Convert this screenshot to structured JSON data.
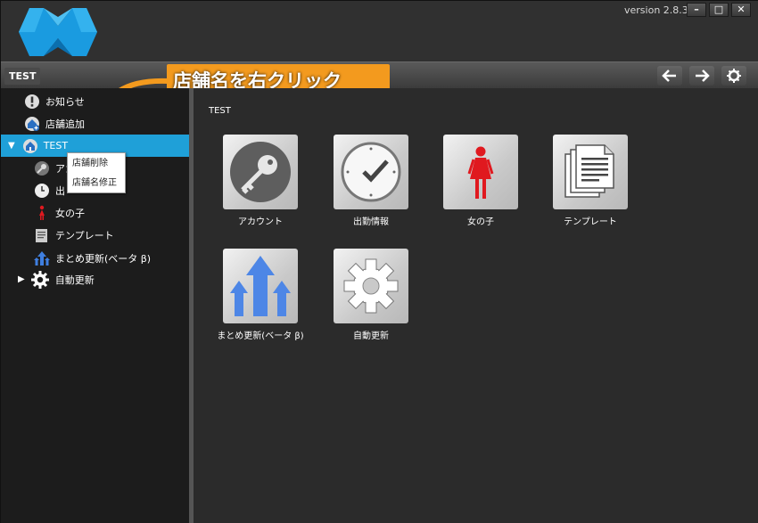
{
  "app": {
    "version": "version 2.8.3",
    "window_buttons": [
      "–",
      "□",
      "✕"
    ]
  },
  "toolbar": {
    "store_name": "TEST",
    "icons": [
      "arrow-left-icon",
      "arrow-right-icon",
      "settings-icon"
    ]
  },
  "annotation": {
    "text": "店舗名を右クリック"
  },
  "sidebar": {
    "items": [
      {
        "label": "お知らせ",
        "icon": "info-icon"
      },
      {
        "label": "店舗追加",
        "icon": "add-store-icon"
      },
      {
        "label": "TEST",
        "icon": "store-icon",
        "selected": true,
        "expanded": true
      },
      {
        "label": "アカ",
        "icon": "key-icon"
      },
      {
        "label": "出",
        "icon": "clock-icon"
      },
      {
        "label": "女の子",
        "icon": "woman-icon"
      },
      {
        "label": "テンプレート",
        "icon": "template-icon"
      },
      {
        "label": "まとめ更新(ベータ β)",
        "icon": "arrows-up-icon"
      },
      {
        "label": "自動更新",
        "icon": "gear-icon"
      }
    ]
  },
  "context_menu": {
    "items": [
      "店舗削除",
      "店舗名修正"
    ]
  },
  "main": {
    "title": "TEST",
    "tiles": [
      {
        "label": "アカウント",
        "icon": "key-icon"
      },
      {
        "label": "出勤情報",
        "icon": "clock-icon"
      },
      {
        "label": "女の子",
        "icon": "woman-icon"
      },
      {
        "label": "テンプレート",
        "icon": "documents-icon"
      },
      {
        "label": "まとめ更新(ベータ β)",
        "icon": "arrows-up-icon"
      },
      {
        "label": "自動更新",
        "icon": "gear-icon"
      }
    ]
  },
  "colors": {
    "accent": "#1fa0d8",
    "annotation": "#f39a1e",
    "logo": "#1a9be0"
  }
}
